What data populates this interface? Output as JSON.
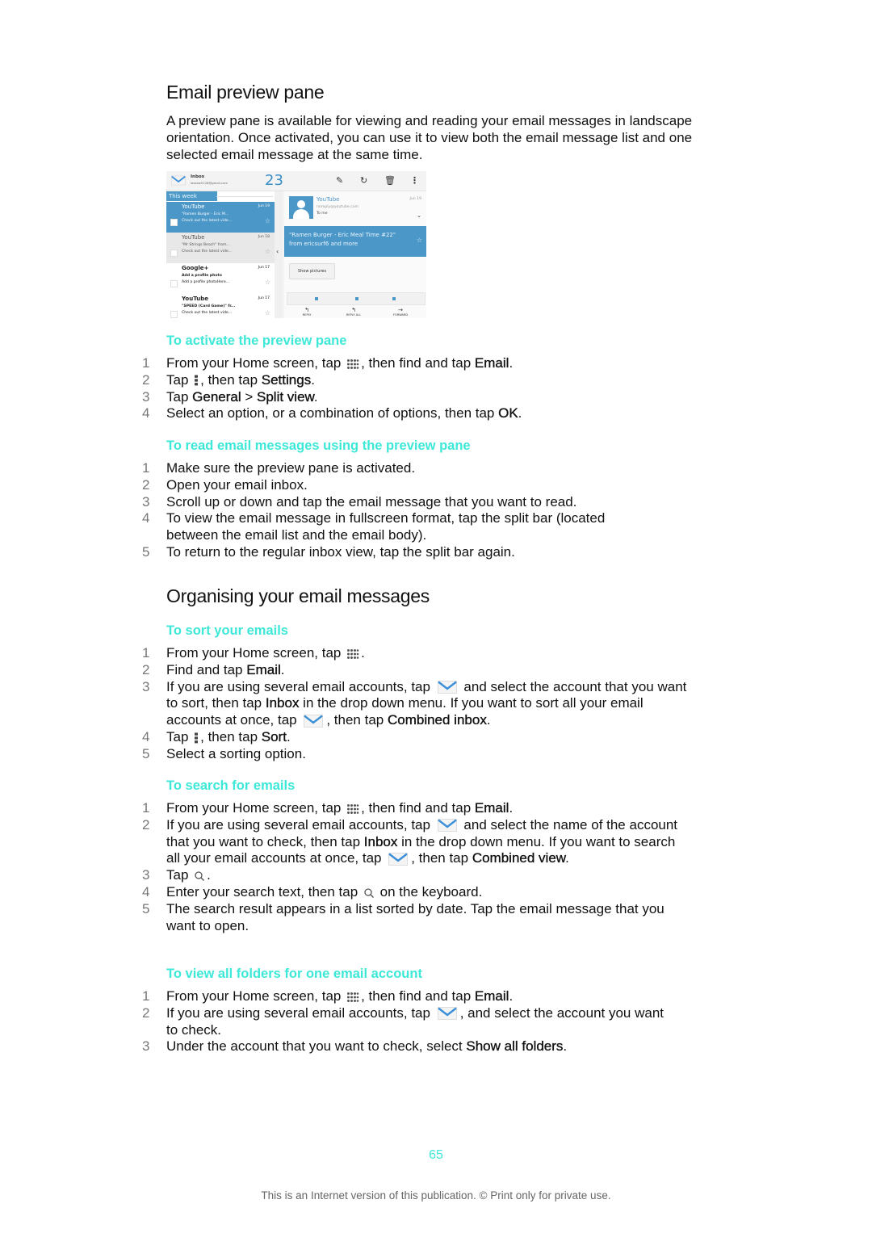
{
  "section1": {
    "title": "Email preview pane",
    "intro": "A preview pane is available for viewing and reading your email messages in landscape orientation. Once activated, you can use it to view both the email message list and one selected email message at the same time."
  },
  "screenshot": {
    "inbox_label": "Inbox",
    "account": "lassew0128@gmail.com",
    "unread_count": "23",
    "group_label": "This week",
    "messages": [
      {
        "from": "YouTube",
        "date": "Jun 19",
        "subject": "\"Ramen Burger - Eric M...",
        "preview": "Check out the latest vide...",
        "state": "selected"
      },
      {
        "from": "YouTube",
        "date": "Jun 18",
        "subject": "\"Mr Strings Beach\" from...",
        "preview": "Check out the latest vide...",
        "state": "read"
      },
      {
        "from": "Google+",
        "date": "Jun 17",
        "subject": "Add a profile photo",
        "preview": "Add a profile photoHere...",
        "state": "unread"
      },
      {
        "from": "YouTube",
        "date": "Jun 17",
        "subject": "\"SPEED (Card Game)\" fr...",
        "preview": "Check out the latest vide...",
        "state": "unread"
      }
    ],
    "reader": {
      "from": "YouTube",
      "email": "noreply@youtube.com",
      "to": "To me",
      "date": "Jun 19",
      "subject": "\"Ramen Burger - Eric Meal Time #22\" from ericsurf6 and more",
      "show_pictures": "Show pictures",
      "actions": [
        "REPLY",
        "REPLY ALL",
        "FORWARD"
      ]
    },
    "colors": {
      "accent": "#4b97c8"
    }
  },
  "activate": {
    "heading": "To activate the preview pane",
    "steps": [
      {
        "n": "1",
        "a": "From your Home screen, tap ",
        "b": ", then find and tap ",
        "c": "Email",
        "d": "."
      },
      {
        "n": "2",
        "a": "Tap ",
        "b": ", then tap ",
        "c": "Settings",
        "d": "."
      },
      {
        "n": "3",
        "a": "Tap ",
        "b1": "General",
        "b2": " > ",
        "c": "Split view",
        "d": "."
      },
      {
        "n": "4",
        "a": "Select an option, or a combination of options, then tap ",
        "c": "OK",
        "d": "."
      }
    ]
  },
  "read": {
    "heading": "To read email messages using the preview pane",
    "steps": [
      {
        "n": "1",
        "t": "Make sure the preview pane is activated."
      },
      {
        "n": "2",
        "t": "Open your email inbox."
      },
      {
        "n": "3",
        "t": "Scroll up or down and tap the email message that you want to read."
      },
      {
        "n": "4",
        "t": "To view the email message in fullscreen format, tap the split bar (located between the email list and the email body)."
      },
      {
        "n": "5",
        "t": "To return to the regular inbox view, tap the split bar again."
      }
    ]
  },
  "section2": {
    "title": "Organising your email messages"
  },
  "sort": {
    "heading": "To sort your emails",
    "s1": {
      "n": "1",
      "a": "From your Home screen, tap ",
      "d": "."
    },
    "s2": {
      "n": "2",
      "a": "Find and tap ",
      "c": "Email",
      "d": "."
    },
    "s3": {
      "n": "3",
      "a": "If you are using several email accounts, tap ",
      "b": " and select the account that you want to sort, then tap ",
      "c": "Inbox",
      "e": " in the drop down menu. If you want to sort all your email accounts at once, tap ",
      "f": ", then tap ",
      "g": "Combined inbox",
      "d": "."
    },
    "s4": {
      "n": "4",
      "a": "Tap ",
      "b": ", then tap ",
      "c": "Sort",
      "d": "."
    },
    "s5": {
      "n": "5",
      "t": "Select a sorting option."
    }
  },
  "search": {
    "heading": "To search for emails",
    "s1": {
      "n": "1",
      "a": "From your Home screen, tap ",
      "b": ", then find and tap ",
      "c": "Email",
      "d": "."
    },
    "s2": {
      "n": "2",
      "a": "If you are using several email accounts, tap ",
      "b": " and select the name of the account that you want to check, then tap ",
      "c": "Inbox",
      "e": " in the drop down menu. If you want to search all your email accounts at once, tap ",
      "f": ", then tap ",
      "g": "Combined view",
      "d": "."
    },
    "s3": {
      "n": "3",
      "a": "Tap ",
      "d": "."
    },
    "s4": {
      "n": "4",
      "a": "Enter your search text, then tap ",
      "b": " on the keyboard."
    },
    "s5": {
      "n": "5",
      "t": "The search result appears in a list sorted by date. Tap the email message that you want to open."
    }
  },
  "folders": {
    "heading": "To view all folders for one email account",
    "s1": {
      "n": "1",
      "a": "From your Home screen, tap ",
      "b": ", then find and tap ",
      "c": "Email",
      "d": "."
    },
    "s2": {
      "n": "2",
      "a": "If you are using several email accounts, tap ",
      "b": ", and select the account you want to check."
    },
    "s3": {
      "n": "3",
      "a": "Under the account that you want to check, select ",
      "c": "Show all folders",
      "d": "."
    }
  },
  "footer": {
    "page_number": "65",
    "notice": "This is an Internet version of this publication. © Print only for private use."
  }
}
